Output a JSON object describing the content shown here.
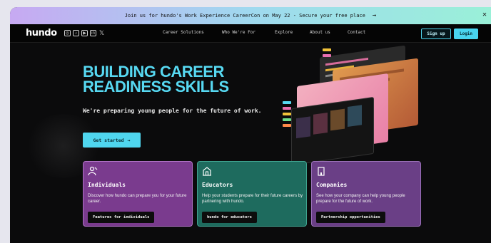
{
  "banner": {
    "text": "Join us for hundo's Work Experience CareerCon on May 22 - Secure your free place",
    "arrow": "→",
    "close": "✕"
  },
  "nav": {
    "logo": "hundo",
    "socials": [
      "instagram-icon",
      "tiktok-icon",
      "youtube-icon",
      "linkedin-icon",
      "x-icon"
    ],
    "menu": [
      "Career Solutions",
      "Who We're For",
      "Explore",
      "About us",
      "Contact"
    ],
    "signup": "Sign up",
    "login": "Login"
  },
  "hero": {
    "headline_line1": "BUILDING CAREER",
    "headline_line2": "READINESS SKILLS",
    "subtext": "We're preparing young people for the future of work.",
    "cta": "Get started",
    "cta_arrow": "→"
  },
  "cards": [
    {
      "title": "Individuals",
      "desc": "Discover how hundo can prepare you for your future career.",
      "button": "Features for individuals",
      "color": "#7a3b8e",
      "icon": "person-icon"
    },
    {
      "title": "Educators",
      "desc": "Help your students prepare for their future careers by partnering with hundo.",
      "button": "hundo for educators",
      "color": "#1e6b5e",
      "icon": "school-icon"
    },
    {
      "title": "Companies",
      "desc": "See how your company can help young people prepare for the future of work.",
      "button": "Partnership opportunities",
      "color": "#6a3f86",
      "icon": "building-icon"
    }
  ],
  "colors": {
    "accent": "#4fd6ef",
    "background": "#0b0b0c"
  }
}
